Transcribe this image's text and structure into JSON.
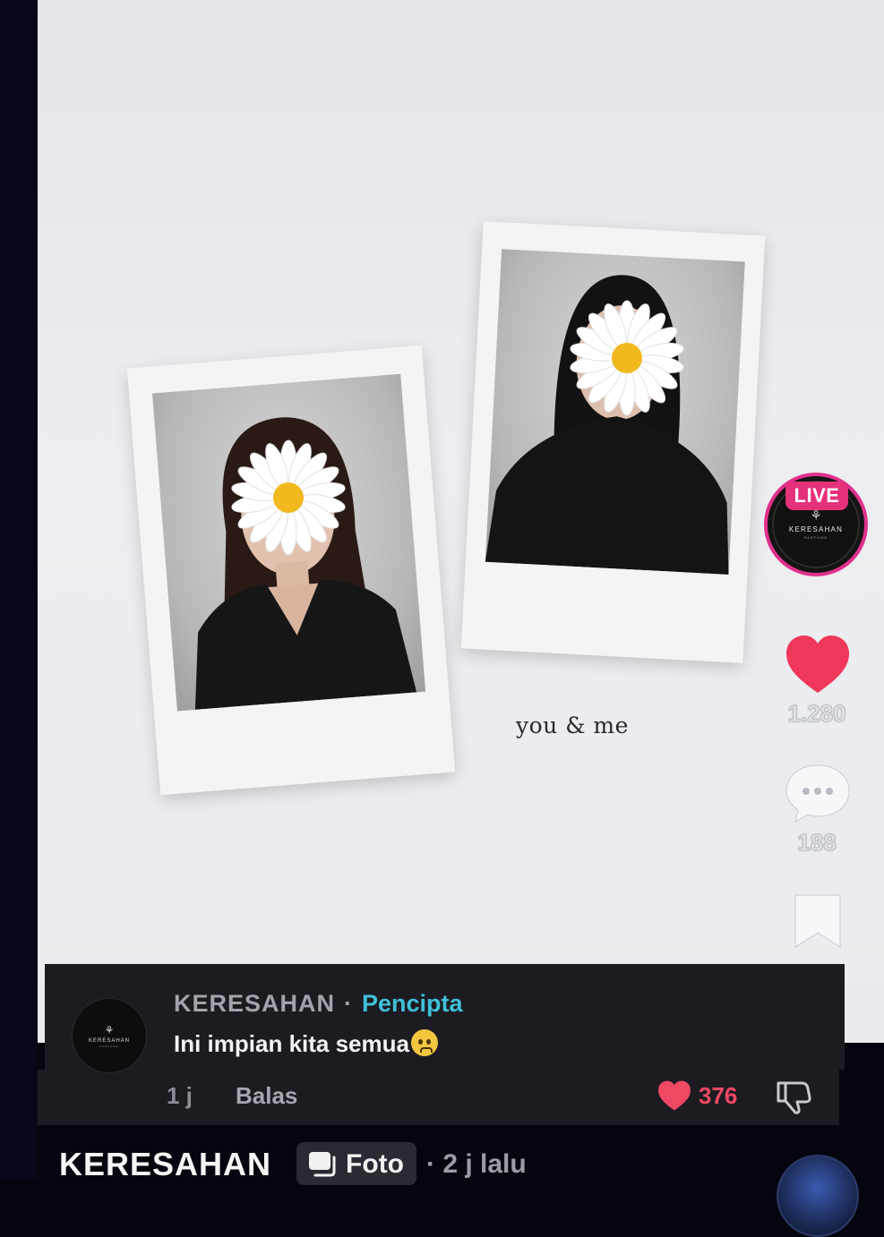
{
  "post": {
    "caption_text": "you & me"
  },
  "rail": {
    "live_badge": "LIVE",
    "live_avatar_brand": "KERESAHAN",
    "live_avatar_sub": "PARFUME",
    "live_avatar_glyph": "⚘",
    "like_count": "1.280",
    "comment_count": "188",
    "like_color": "#f0385a",
    "live_ring_color": "#e0308c"
  },
  "comment": {
    "avatar_brand": "KERESAHAN",
    "avatar_sub": "PARFUME",
    "avatar_glyph": "⚘",
    "author": "KERESAHAN",
    "separator": "·",
    "role": "Pencipta",
    "text": "Ini impian kita semua",
    "emoji": "pleading-face-icon",
    "time": "1 j",
    "reply_label": "Balas",
    "like_count": "376"
  },
  "footer": {
    "author": "KERESAHAN",
    "type_label": "Foto",
    "time": "· 2 j lalu"
  }
}
